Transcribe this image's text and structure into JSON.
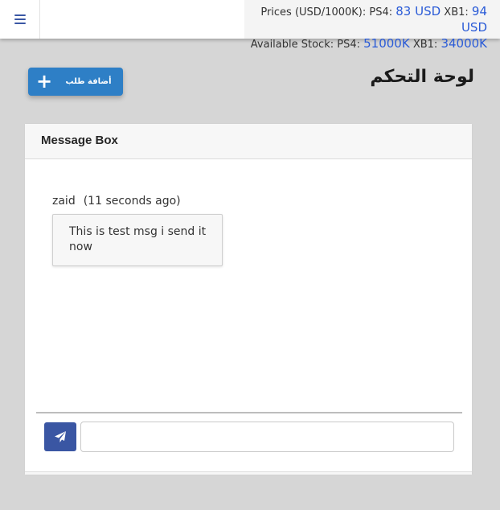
{
  "topbar": {
    "menu_icon": "hamburger-icon",
    "prices_label": "Prices (USD/1000K): ",
    "ps4_label": "PS4: ",
    "ps4_price": "83 USD",
    "xb1_label": " XB1: ",
    "xb1_price": "94 USD",
    "stock_label": "Available Stock: ",
    "ps4_stock_label": "PS4: ",
    "ps4_stock": "51000K",
    "xb1_stock_label": " XB1: ",
    "xb1_stock": "34000K"
  },
  "header": {
    "title": "لوحة التحكم",
    "add_button_label": "أضافة طلب",
    "add_button_icon": "plus-icon"
  },
  "message_box": {
    "title": "Message Box",
    "messages": [
      {
        "author": "zaid",
        "time": "(11 seconds ago)",
        "text": "This is test msg i send it now"
      }
    ],
    "send_icon": "paper-plane-icon",
    "input_value": "",
    "input_placeholder": ""
  },
  "colors": {
    "accent_blue": "#2e7fc6",
    "send_button": "#3a56a3",
    "value_blue": "#2a5bd7",
    "background": "#d6d6d6"
  }
}
